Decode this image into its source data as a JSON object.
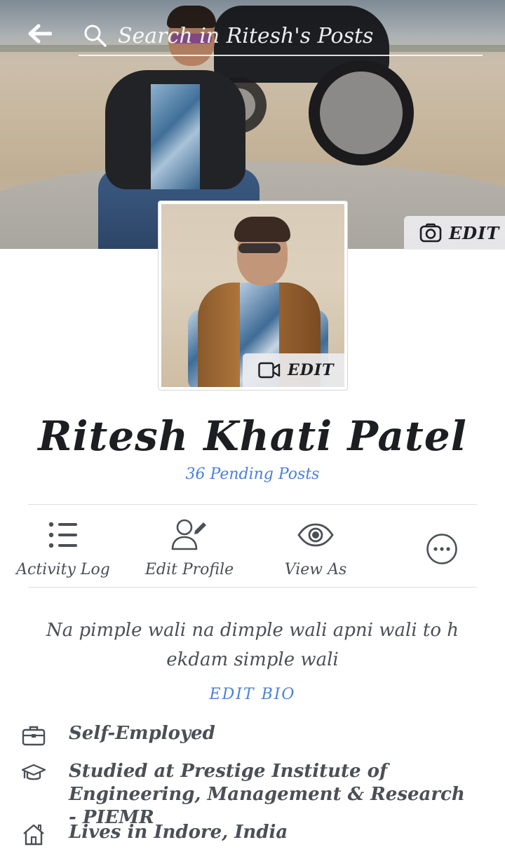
{
  "header": {
    "search_placeholder": "Search in Ritesh's Posts",
    "back_icon": "back-arrow-icon",
    "search_icon": "search-icon"
  },
  "cover": {
    "edit_label": "EDIT",
    "edit_icon": "camera-icon"
  },
  "profile_picture": {
    "edit_label": "EDIT",
    "edit_icon": "video-camera-icon"
  },
  "profile": {
    "name": "Ritesh Khati Patel",
    "pending_posts": "36 Pending Posts"
  },
  "actions": [
    {
      "label": "Activity Log",
      "icon": "list-icon"
    },
    {
      "label": "Edit Profile",
      "icon": "edit-profile-icon"
    },
    {
      "label": "View As",
      "icon": "eye-icon"
    },
    {
      "label": "",
      "icon": "more-icon"
    }
  ],
  "bio": {
    "text": "Na pimple wali na dimple wali apni wali to h ekdam simple wali",
    "edit_label": "EDIT BIO"
  },
  "details": [
    {
      "icon": "briefcase-icon",
      "text": "Self-Employed"
    },
    {
      "icon": "graduation-cap-icon",
      "text": "Studied at Prestige Institute of Engineering, Management & Research - PIEMR"
    },
    {
      "icon": "home-icon",
      "text": "Lives in Indore, India"
    }
  ],
  "colors": {
    "link_blue": "#4a80d9",
    "text_dark": "#1c1e21",
    "text_gray": "#4b4f56",
    "divider": "#dddfe2"
  }
}
